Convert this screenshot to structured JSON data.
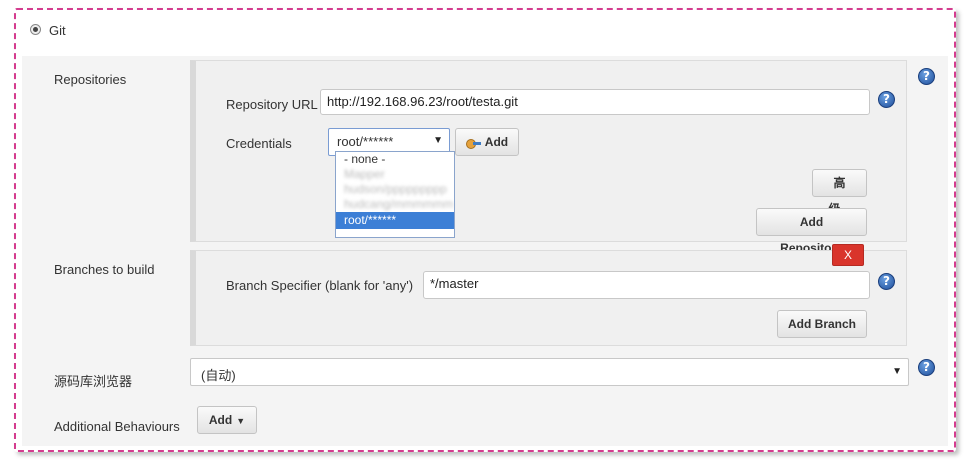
{
  "git": {
    "label": "Git"
  },
  "repositories": {
    "section_label": "Repositories",
    "url_label": "Repository URL",
    "url_value": "http://192.168.96.23/root/testa.git",
    "credentials_label": "Credentials",
    "credentials_selected": "root/******",
    "add_button": "Add",
    "dropdown": {
      "items": [
        {
          "label": "- none -",
          "state": "normal"
        },
        {
          "label": "Mapper",
          "state": "blurred"
        },
        {
          "label": "hudson/ppppppppp",
          "state": "blurred"
        },
        {
          "label": "hudcang/mmmmmm",
          "state": "blurred"
        },
        {
          "label": "root/******",
          "state": "selected"
        }
      ]
    },
    "advanced_button": "高级...",
    "add_repository_button": "Add Repository"
  },
  "branches": {
    "section_label": "Branches to build",
    "delete_label": "X",
    "specifier_label": "Branch Specifier (blank for 'any')",
    "specifier_value": "*/master",
    "add_branch_button": "Add Branch"
  },
  "browser": {
    "section_label": "源码库浏览器",
    "selected": "(自动)"
  },
  "behaviours": {
    "section_label": "Additional Behaviours",
    "add_button": "Add"
  },
  "icons": {
    "help": "help-icon",
    "key": "key-icon",
    "dropdown_arrow": "chevron-down-icon"
  },
  "colors": {
    "delete_red": "#d9342b",
    "selection_blue": "#3c7fd6",
    "help_blue": "#1f4f9b",
    "frame_pink": "#d43c8f"
  }
}
